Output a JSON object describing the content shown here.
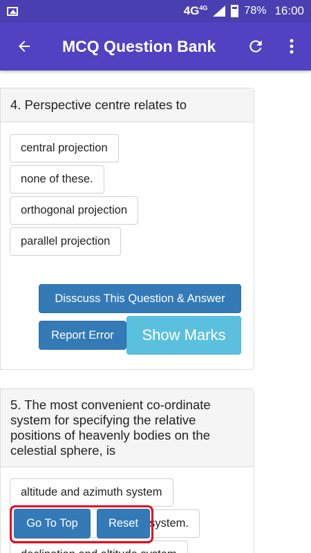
{
  "status_bar": {
    "network": "4G",
    "network_sup": "4G",
    "battery": "78%",
    "time": "16:00"
  },
  "app_bar": {
    "title": "MCQ Question Bank",
    "icons": [
      "back-arrow-icon",
      "refresh-icon",
      "more-vert-icon"
    ]
  },
  "questions": [
    {
      "text": "4. Perspective centre relates to",
      "options": [
        "central projection",
        "none of these.",
        "orthogonal projection",
        "parallel projection"
      ],
      "discuss_label": "Disscuss This Question & Answer",
      "report_label": "Report Error",
      "marks_label": "Show Marks"
    },
    {
      "text": "5. The most convenient co-ordinate system for specifying the relative positions of heavenly bodies on the celestial sphere, is",
      "options": [
        "altitude and azimuth system",
        "system.",
        "declination and altitude system"
      ]
    }
  ],
  "floating": {
    "go_top_label": "Go To Top",
    "reset_label": "Reset"
  },
  "colors": {
    "status_bar": "#4a3fb0",
    "app_bar": "#5142c2",
    "primary_button": "#337ab7",
    "info_button": "#5bc0de",
    "highlight_border": "#e8001c"
  }
}
